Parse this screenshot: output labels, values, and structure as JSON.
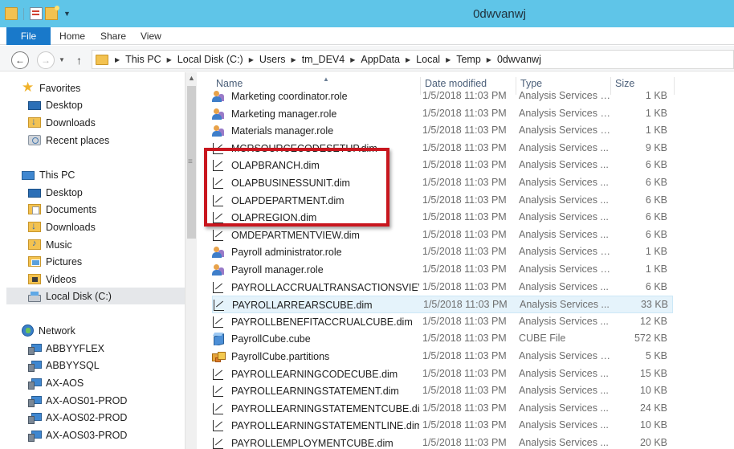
{
  "window": {
    "title": "0dwvanwj"
  },
  "ribbon": {
    "tabs": [
      "File",
      "Home",
      "Share",
      "View"
    ]
  },
  "address": {
    "breadcrumbs": [
      "This PC",
      "Local Disk (C:)",
      "Users",
      "tm_DEV4",
      "AppData",
      "Local",
      "Temp",
      "0dwvanwj"
    ]
  },
  "navpane": {
    "favorites": {
      "label": "Favorites",
      "items": [
        "Desktop",
        "Downloads",
        "Recent places"
      ]
    },
    "thispc": {
      "label": "This PC",
      "items": [
        "Desktop",
        "Documents",
        "Downloads",
        "Music",
        "Pictures",
        "Videos",
        "Local Disk (C:)"
      ]
    },
    "network": {
      "label": "Network",
      "items": [
        "ABBYYFLEX",
        "ABBYYSQL",
        "AX-AOS",
        "AX-AOS01-PROD",
        "AX-AOS02-PROD",
        "AX-AOS03-PROD"
      ]
    }
  },
  "columns": {
    "name": "Name",
    "date": "Date modified",
    "type": "Type",
    "size": "Size"
  },
  "files": [
    {
      "name": "Marketing coordinator.role",
      "icon": "role",
      "date": "1/5/2018 11:03 PM",
      "type": "Analysis Services R...",
      "size": "1 KB"
    },
    {
      "name": "Marketing manager.role",
      "icon": "role",
      "date": "1/5/2018 11:03 PM",
      "type": "Analysis Services R...",
      "size": "1 KB"
    },
    {
      "name": "Materials manager.role",
      "icon": "role",
      "date": "1/5/2018 11:03 PM",
      "type": "Analysis Services R...",
      "size": "1 KB"
    },
    {
      "name": "MCRSOURCECODESETUP.dim",
      "icon": "dim",
      "date": "1/5/2018 11:03 PM",
      "type": "Analysis Services ...",
      "size": "9 KB"
    },
    {
      "name": "OLAPBRANCH.dim",
      "icon": "dim",
      "date": "1/5/2018 11:03 PM",
      "type": "Analysis Services ...",
      "size": "6 KB"
    },
    {
      "name": "OLAPBUSINESSUNIT.dim",
      "icon": "dim",
      "date": "1/5/2018 11:03 PM",
      "type": "Analysis Services ...",
      "size": "6 KB"
    },
    {
      "name": "OLAPDEPARTMENT.dim",
      "icon": "dim",
      "date": "1/5/2018 11:03 PM",
      "type": "Analysis Services ...",
      "size": "6 KB"
    },
    {
      "name": "OLAPREGION.dim",
      "icon": "dim",
      "date": "1/5/2018 11:03 PM",
      "type": "Analysis Services ...",
      "size": "6 KB"
    },
    {
      "name": "OMDEPARTMENTVIEW.dim",
      "icon": "dim",
      "date": "1/5/2018 11:03 PM",
      "type": "Analysis Services ...",
      "size": "6 KB"
    },
    {
      "name": "Payroll administrator.role",
      "icon": "role",
      "date": "1/5/2018 11:03 PM",
      "type": "Analysis Services R...",
      "size": "1 KB"
    },
    {
      "name": "Payroll manager.role",
      "icon": "role",
      "date": "1/5/2018 11:03 PM",
      "type": "Analysis Services R...",
      "size": "1 KB"
    },
    {
      "name": "PAYROLLACCRUALTRANSACTIONSVIEW....",
      "icon": "dim",
      "date": "1/5/2018 11:03 PM",
      "type": "Analysis Services ...",
      "size": "6 KB"
    },
    {
      "name": "PAYROLLARREARSCUBE.dim",
      "icon": "dim",
      "date": "1/5/2018 11:03 PM",
      "type": "Analysis Services ...",
      "size": "33 KB",
      "selected": true
    },
    {
      "name": "PAYROLLBENEFITACCRUALCUBE.dim",
      "icon": "dim",
      "date": "1/5/2018 11:03 PM",
      "type": "Analysis Services ...",
      "size": "12 KB"
    },
    {
      "name": "PayrollCube.cube",
      "icon": "cube",
      "date": "1/5/2018 11:03 PM",
      "type": "CUBE File",
      "size": "572 KB"
    },
    {
      "name": "PayrollCube.partitions",
      "icon": "partitions",
      "date": "1/5/2018 11:03 PM",
      "type": "Analysis Services P...",
      "size": "5 KB"
    },
    {
      "name": "PAYROLLEARNINGCODECUBE.dim",
      "icon": "dim",
      "date": "1/5/2018 11:03 PM",
      "type": "Analysis Services ...",
      "size": "15 KB"
    },
    {
      "name": "PAYROLLEARNINGSTATEMENT.dim",
      "icon": "dim",
      "date": "1/5/2018 11:03 PM",
      "type": "Analysis Services ...",
      "size": "10 KB"
    },
    {
      "name": "PAYROLLEARNINGSTATEMENTCUBE.dim",
      "icon": "dim",
      "date": "1/5/2018 11:03 PM",
      "type": "Analysis Services ...",
      "size": "24 KB"
    },
    {
      "name": "PAYROLLEARNINGSTATEMENTLINE.dim",
      "icon": "dim",
      "date": "1/5/2018 11:03 PM",
      "type": "Analysis Services ...",
      "size": "10 KB"
    },
    {
      "name": "PAYROLLEMPLOYMENTCUBE.dim",
      "icon": "dim",
      "date": "1/5/2018 11:03 PM",
      "type": "Analysis Services ...",
      "size": "20 KB"
    }
  ],
  "colors": {
    "titlebar": "#5fc5e8",
    "file_tab": "#1979ca",
    "highlight_box": "#c8161e",
    "selection": "#e5f3fb"
  }
}
